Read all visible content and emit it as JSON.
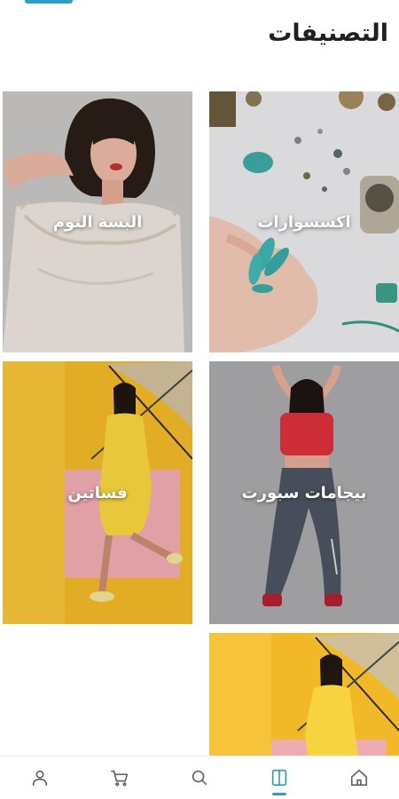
{
  "header": {
    "title": "التصنيفات"
  },
  "categories": [
    {
      "label": "اكسسوارات"
    },
    {
      "label": "البسة النوم"
    },
    {
      "label": "بيجامات سبورت"
    },
    {
      "label": "فساتين"
    },
    {
      "label": ""
    }
  ],
  "colors": {
    "accent": "#2f9cc6",
    "icon": "#5f6368",
    "title": "#1f1f1f"
  },
  "bottom_nav": {
    "items": [
      {
        "icon": "user-icon"
      },
      {
        "icon": "cart-icon"
      },
      {
        "icon": "search-icon"
      },
      {
        "icon": "book-icon",
        "active": true
      },
      {
        "icon": "home-icon"
      }
    ]
  }
}
